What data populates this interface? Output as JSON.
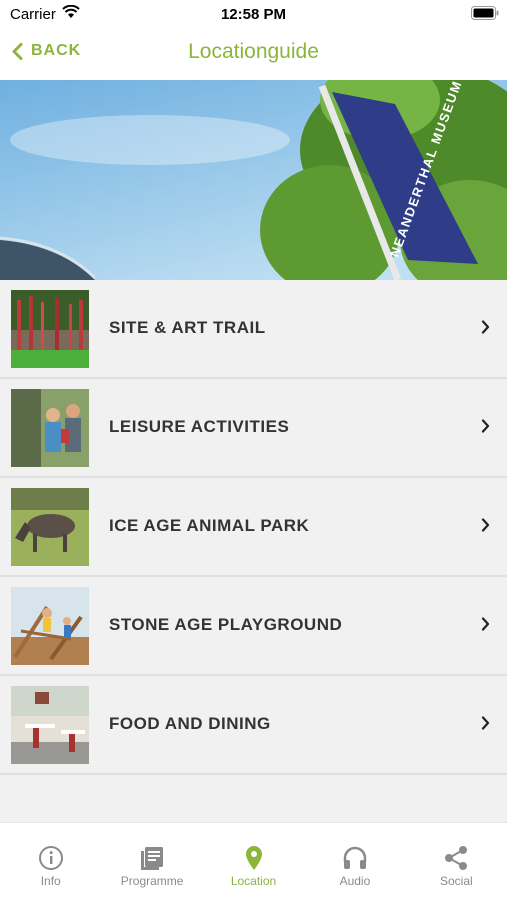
{
  "status_bar": {
    "carrier": "Carrier",
    "time": "12:58 PM"
  },
  "nav": {
    "back_label": "BACK",
    "title": "Locationguide"
  },
  "hero": {
    "flag_text": "NEANDERTHAL MUSEUM"
  },
  "items": [
    {
      "label": "SITE & ART TRAIL"
    },
    {
      "label": "LEISURE ACTIVITIES"
    },
    {
      "label": "ICE AGE ANIMAL PARK"
    },
    {
      "label": "STONE AGE PLAYGROUND"
    },
    {
      "label": "FOOD AND DINING"
    }
  ],
  "tabs": [
    {
      "label": "Info",
      "icon": "info-icon"
    },
    {
      "label": "Programme",
      "icon": "programme-icon"
    },
    {
      "label": "Location",
      "icon": "location-pin-icon",
      "active": true
    },
    {
      "label": "Audio",
      "icon": "headphones-icon"
    },
    {
      "label": "Social",
      "icon": "share-icon"
    }
  ],
  "colors": {
    "accent": "#8cb53b",
    "text": "#333333",
    "background": "#f1f1f1"
  }
}
